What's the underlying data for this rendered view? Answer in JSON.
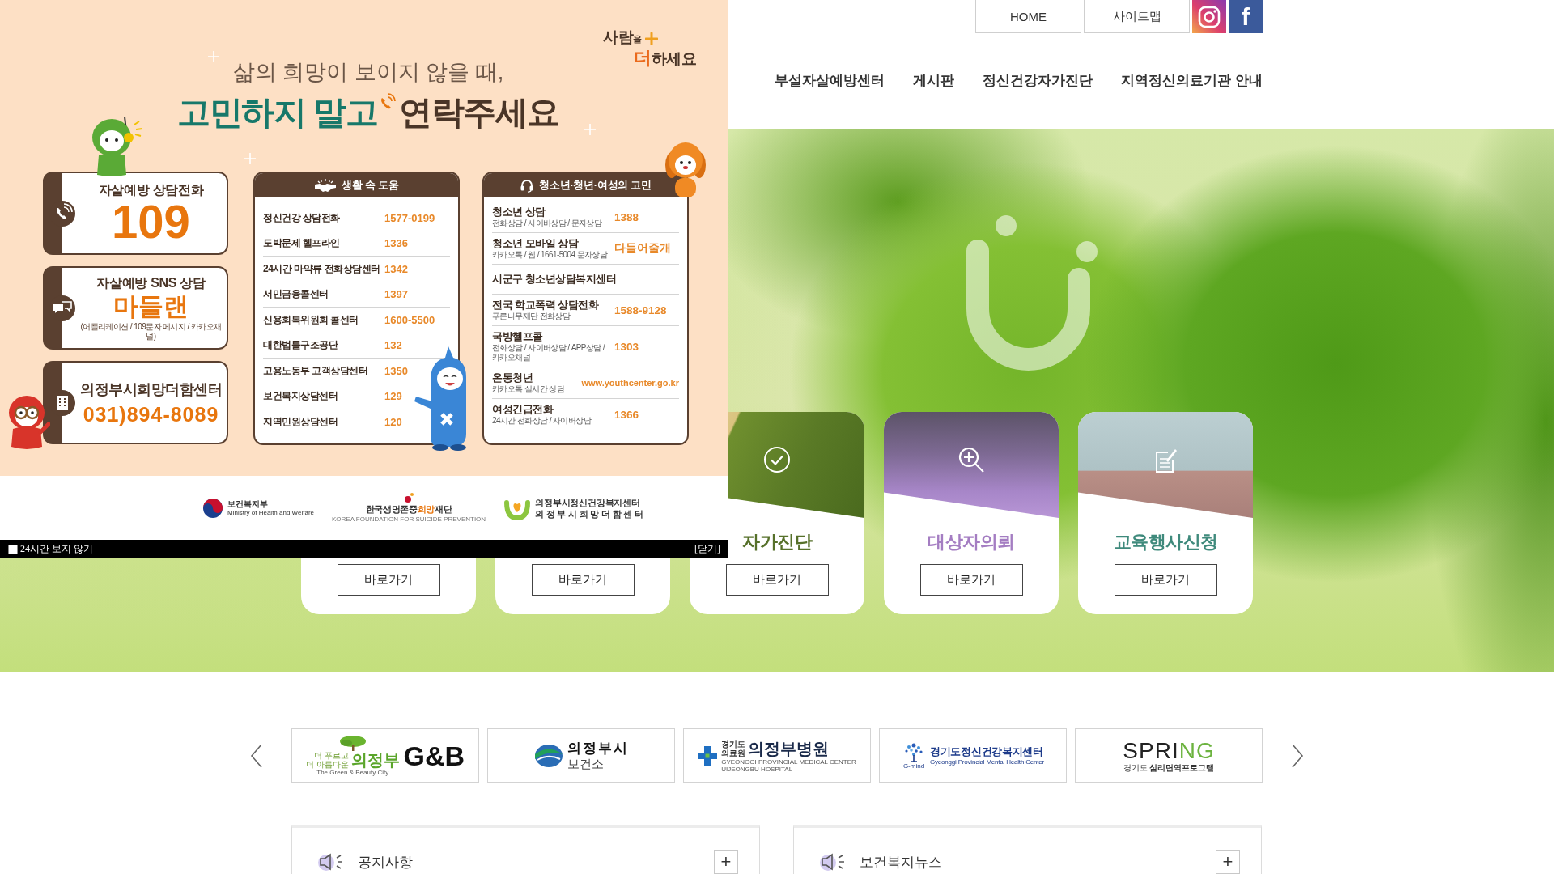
{
  "header": {
    "utility_links": [
      {
        "label": "HOME"
      },
      {
        "label": "사이트맵"
      }
    ],
    "social": [
      {
        "kind": "instagram"
      },
      {
        "kind": "facebook",
        "text": "f"
      }
    ],
    "nav": [
      {
        "label": "부설자살예방센터"
      },
      {
        "label": "게시판"
      },
      {
        "label": "정신건강자가진단"
      },
      {
        "label": "지역정신의료기관 안내"
      }
    ]
  },
  "hero": {
    "cards": [
      {
        "button": "바로가기"
      },
      {
        "button": "바로가기"
      },
      {
        "kind": "diagnosis",
        "title": "자가진단",
        "color": "#56702a",
        "button": "바로가기"
      },
      {
        "kind": "referral",
        "title": "대상자의뢰",
        "color": "#a47dc2",
        "button": "바로가기"
      },
      {
        "kind": "application",
        "title": "교육행사신청",
        "color": "#3f8a7c",
        "button": "바로가기"
      }
    ]
  },
  "partners": {
    "logos": [
      {
        "kind": "city",
        "tagline": [
          "더 푸르고",
          "더 아름다운"
        ],
        "name": "의정부",
        "mark": "G&B",
        "caption": "The Green & Beauty City"
      },
      {
        "kind": "clinic",
        "lines": [
          "의정부시",
          "보건소"
        ]
      },
      {
        "kind": "hospital",
        "prefix": [
          "경기도",
          "의료원"
        ],
        "name": "의정부병원",
        "caption": [
          "GYEONGGI PROVINCIAL MEDICAL CENTER",
          "UIJEONGBU HOSPITAL"
        ]
      },
      {
        "kind": "center",
        "badge": "G-mind",
        "name": "경기도정신건강복지센터",
        "caption": "Gyeonggi Provincial Mental Health Center"
      },
      {
        "kind": "program",
        "name": [
          {
            "text": "SPRI",
            "accent": false
          },
          {
            "text": "NG",
            "accent": true
          }
        ],
        "caption": "경기도 **심리면역프로그램**"
      }
    ]
  },
  "boards": [
    {
      "title": "공지사항",
      "button": "+"
    },
    {
      "title": "보건복지뉴스",
      "button": "+"
    }
  ],
  "popup": {
    "slogan": [
      [
        {
          "text": "사람$_{을}$",
          "accent": false
        }
      ],
      [
        {
          "text": "더",
          "accent": true
        },
        {
          "text": "하세요",
          "accent": false
        }
      ]
    ],
    "subtitle": "삶의 희망이 보이지 않을 때,",
    "headline": [
      "고민하지 말고",
      "연락주세요"
    ],
    "hotlines": [
      {
        "kind": "phone",
        "title": "자살예방 상담전화",
        "value": "109"
      },
      {
        "kind": "chat",
        "title": "자살예방 SNS 상담",
        "value": "마들랜",
        "note": "(어플리케이션 / 109문자 메시지 / 카카오채널)"
      },
      {
        "kind": "center",
        "title": "의정부시희망더함센터",
        "value": "031)894-8089"
      }
    ],
    "panels": [
      {
        "kind": "life",
        "title": "생활 속 도움",
        "rows": [
          {
            "label": "정신건강 상담전화",
            "value": "1577-0199"
          },
          {
            "label": "도박문제 헬프라인",
            "value": "1336"
          },
          {
            "label": "24시간 마약류 전화상담센터",
            "value": "1342"
          },
          {
            "label": "서민금융콜센터",
            "value": "1397"
          },
          {
            "label": "신용회복위원회 콜센터",
            "value": "1600-5500"
          },
          {
            "label": "대한법률구조공단",
            "value": "132"
          },
          {
            "label": "고용노동부 고객상담센터",
            "value": "1350"
          },
          {
            "label": "보건복지상담센터",
            "value": "129"
          },
          {
            "label": "지역민원상담센터",
            "value": "120"
          }
        ]
      },
      {
        "kind": "youth",
        "title": "청소년·청년·여성의 고민",
        "rows": [
          {
            "kind": "call",
            "label": "청소년 상담",
            "note": "전화상담 / 사이버상담 / 문자상담",
            "value": "1388"
          },
          {
            "kind": "call",
            "label": "청소년 모바일 상담",
            "note": "카카오톡 / 웹 / 1661-5004 문자상담",
            "value": "다들어줄개"
          },
          {
            "label": "시군구 청소년상담복지센터"
          },
          {
            "kind": "call",
            "label": "전국 학교폭력 상담전화",
            "note": "푸른나무재단 전화상담",
            "value": "1588-9128"
          },
          {
            "kind": "call",
            "label": "국방헬프콜",
            "note": "전화상담 / 사이버상담 / APP상담 / 카카오채널",
            "value": "1303"
          },
          {
            "kind": "web",
            "label": "온통청년",
            "note": "카카오톡 실시간 상담",
            "value": "www.youthcenter.go.kr"
          },
          {
            "kind": "call",
            "label": "여성긴급전화",
            "note": "24시간 전화상담 / 사이버상담",
            "value": "1366"
          }
        ]
      }
    ],
    "sponsors": [
      {
        "kind": "ministry",
        "name": "보건복지부",
        "english": "Ministry of Health and Welfare"
      },
      {
        "kind": "foundation",
        "name": [
          {
            "text": "한국생명존중",
            "accent": false
          },
          {
            "text": "희망",
            "accent": true
          },
          {
            "text": "재단",
            "accent": false
          }
        ],
        "english": "KOREA FOUNDATION FOR SUICIDE PREVENTION"
      },
      {
        "kind": "center",
        "lines": [
          "의정부시정신건강복지센터",
          "의 정 부 시 희 망 더 함 센 터"
        ]
      }
    ],
    "footer": {
      "checked": false,
      "label": "24시간 보지 않기",
      "close": "[닫기]"
    }
  }
}
